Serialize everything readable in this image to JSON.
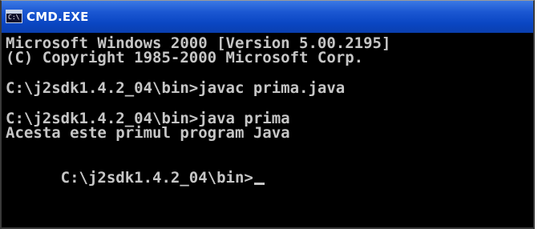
{
  "window": {
    "title": "CMD.EXE",
    "icon_label": "C:\\"
  },
  "console": {
    "lines": [
      "Microsoft Windows 2000 [Version 5.00.2195]",
      "(C) Copyright 1985-2000 Microsoft Corp.",
      "C:\\j2sdk1.4.2_04\\bin>javac prima.java",
      "C:\\j2sdk1.4.2_04\\bin>java prima",
      "Acesta este primul program Java",
      "C:\\j2sdk1.4.2_04\\bin>"
    ]
  },
  "colors": {
    "titlebar": "#0a46c3",
    "console_background": "#000000",
    "console_text": "#c6c6c6"
  }
}
